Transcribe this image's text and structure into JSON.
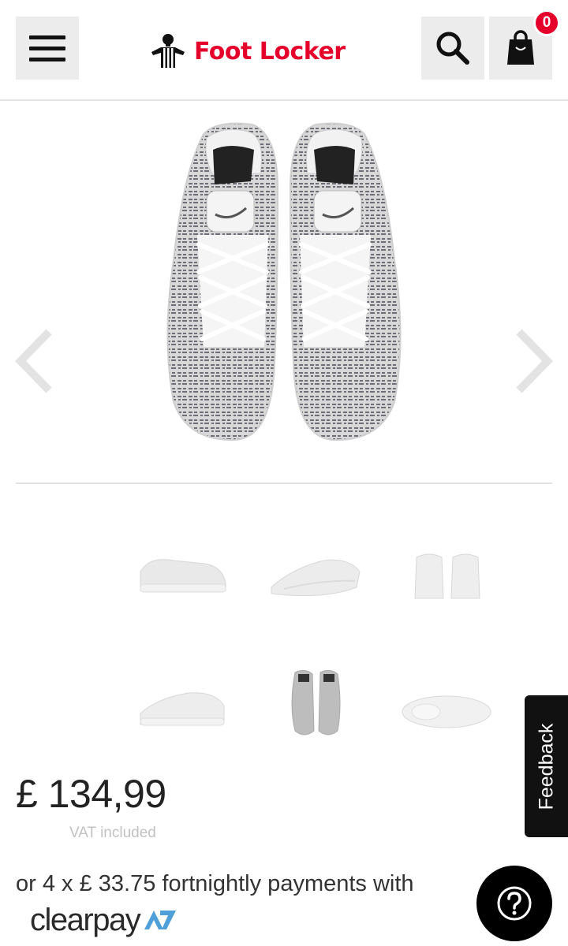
{
  "header": {
    "brand": "Foot Locker",
    "bag_count": "0",
    "icons": {
      "menu": "hamburger-menu-icon",
      "search": "search-icon",
      "bag": "shopping-bag-icon",
      "logo": "referee-mascot-icon"
    }
  },
  "gallery": {
    "main_image": "sneaker-top-view-image",
    "prev_icon": "chevron-left-icon",
    "next_icon": "chevron-right-icon",
    "thumbnails": [
      "side-view",
      "angled-view",
      "back-view",
      "side-view-alt",
      "top-view",
      "sole-view"
    ]
  },
  "product": {
    "price": "£ 134,99",
    "vat_note": "VAT included"
  },
  "payment": {
    "installments_text": "or 4 x £ 33.75 fortnightly payments with",
    "provider": "clearpay"
  },
  "widgets": {
    "feedback_label": "Feedback",
    "help_icon": "question-icon"
  },
  "colors": {
    "brand_red": "#e5002b",
    "icon_button_bg": "#ececec",
    "dark": "#111111",
    "clearpay_arrow": "#4f9fd8"
  }
}
